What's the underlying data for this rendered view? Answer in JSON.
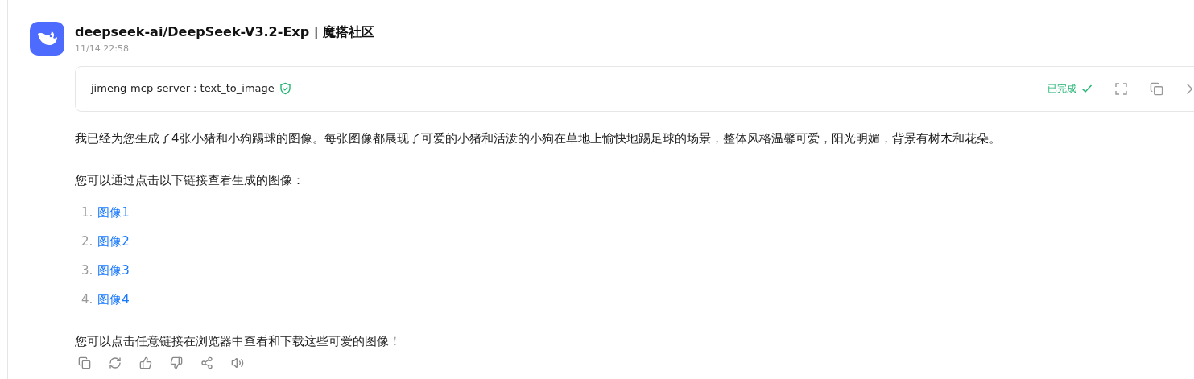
{
  "message": {
    "title": "deepseek-ai/DeepSeek-V3.2-Exp | 魔搭社区",
    "time": "11/14 22:58"
  },
  "tool_call": {
    "name": "jimeng-mcp-server : text_to_image",
    "status": "已完成",
    "completed": true
  },
  "paragraphs": [
    "我已经为您生成了4张小猪和小狗踢球的图像。每张图像都展现了可爱的小猪和活泼的小狗在草地上愉快地踢足球的场景，整体风格温馨可爱，阳光明媚，背景有树木和花朵。",
    "您可以通过点击以下链接查看生成的图像："
  ],
  "links": [
    {
      "number": "1.",
      "label": "图像1"
    },
    {
      "number": "2.",
      "label": "图像2"
    },
    {
      "number": "3.",
      "label": "图像3"
    },
    {
      "number": "4.",
      "label": "图像4"
    }
  ],
  "closing": "您可以点击任意链接在浏览器中查看和下载这些可爱的图像！"
}
